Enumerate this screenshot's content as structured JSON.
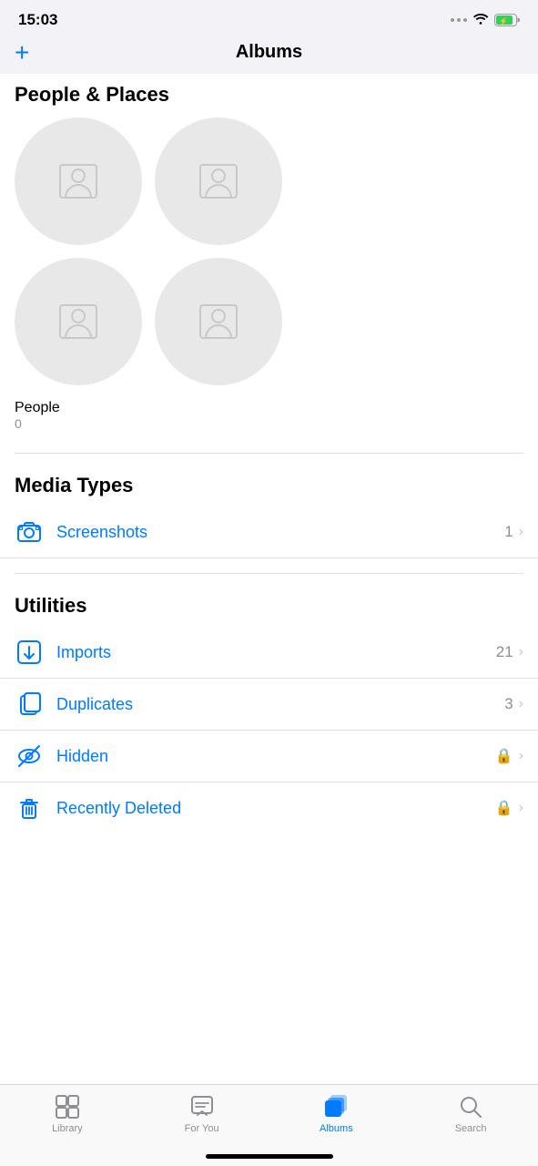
{
  "statusBar": {
    "time": "15:03"
  },
  "navBar": {
    "title": "Albums",
    "addButton": "+"
  },
  "sections": {
    "peopleAndPlaces": {
      "label": "People & Places",
      "people": {
        "name": "People",
        "count": "0"
      }
    },
    "mediaTypes": {
      "label": "Media Types",
      "items": [
        {
          "icon": "screenshot-icon",
          "label": "Screenshots",
          "count": "1",
          "lock": false
        }
      ]
    },
    "utilities": {
      "label": "Utilities",
      "items": [
        {
          "icon": "imports-icon",
          "label": "Imports",
          "count": "21",
          "lock": false
        },
        {
          "icon": "duplicates-icon",
          "label": "Duplicates",
          "count": "3",
          "lock": false
        },
        {
          "icon": "hidden-icon",
          "label": "Hidden",
          "count": "",
          "lock": true
        },
        {
          "icon": "recently-deleted-icon",
          "label": "Recently Deleted",
          "count": "",
          "lock": true
        }
      ]
    }
  },
  "tabBar": {
    "items": [
      {
        "id": "library",
        "label": "Library",
        "active": false
      },
      {
        "id": "for-you",
        "label": "For You",
        "active": false
      },
      {
        "id": "albums",
        "label": "Albums",
        "active": true
      },
      {
        "id": "search",
        "label": "Search",
        "active": false
      }
    ]
  }
}
